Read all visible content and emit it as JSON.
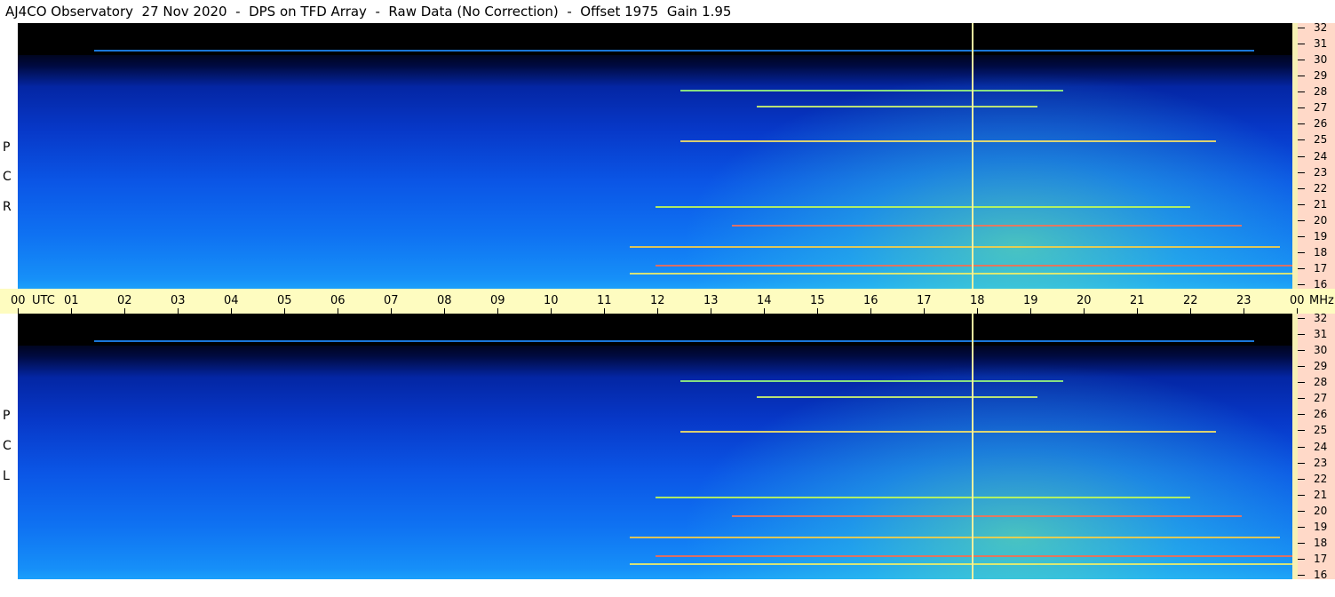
{
  "title": "AJ4CO Observatory  27 Nov 2020  -  DPS on TFD Array  -  Raw Data (No Correction)  -  Offset 1975  Gain 1.95",
  "panels": [
    {
      "id": "rcp",
      "label_letters": [
        "P",
        "C",
        "R"
      ]
    },
    {
      "id": "lcp",
      "label_letters": [
        "P",
        "C",
        "L"
      ]
    }
  ],
  "freq_scale": {
    "unit": "MHz",
    "labels": [
      "32",
      "31",
      "30",
      "29",
      "28",
      "27",
      "26",
      "25",
      "24",
      "23",
      "22",
      "21",
      "20",
      "19",
      "18",
      "17",
      "16"
    ]
  },
  "time_axis": {
    "labels": [
      "00",
      "UTC",
      "01",
      "02",
      "03",
      "04",
      "05",
      "06",
      "07",
      "08",
      "09",
      "10",
      "11",
      "12",
      "13",
      "14",
      "15",
      "16",
      "17",
      "18",
      "19",
      "20",
      "21",
      "22",
      "23",
      "00",
      "MHz"
    ]
  },
  "colors": {
    "marker": "#f0f0a0",
    "scale_bg": "#ffd9c8",
    "timebar_bg": "#fefcc0"
  }
}
